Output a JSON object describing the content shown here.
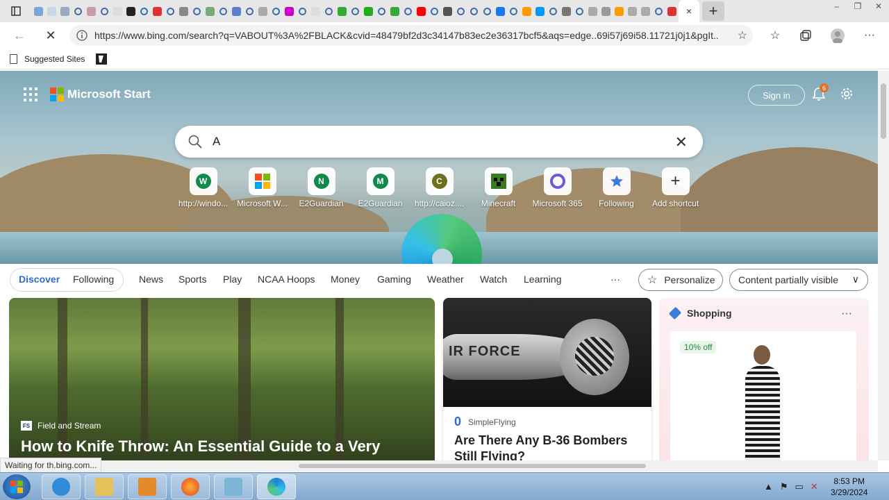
{
  "browser": {
    "active_tab_close": "×",
    "new_tab": "+",
    "window_controls": [
      "–",
      "❐",
      "✕"
    ],
    "url": "https://www.bing.com/search?q=VABOUT%3A%2FBLACK&cvid=48479bf2d3c34147b83ec2e36317bcf5&aqs=edge..69i57j69i58.11721j0j1&pgIt...",
    "favorites_bar": {
      "items": [
        "Suggested Sites"
      ]
    }
  },
  "page": {
    "brand": "Microsoft Start",
    "sign_in": "Sign in",
    "notification_count": "6",
    "search": {
      "value": "A"
    },
    "shortcuts": [
      {
        "label": "http://windo...",
        "letter": "W",
        "color": "#0f8a4a"
      },
      {
        "label": "Microsoft W...",
        "letter": "",
        "color": ""
      },
      {
        "label": "E2Guardian",
        "letter": "N",
        "color": "#0f8a4a"
      },
      {
        "label": "E2Guardian",
        "letter": "M",
        "color": "#0f8a4a"
      },
      {
        "label": "http://caioz....",
        "letter": "C",
        "color": "#6e6e1c"
      },
      {
        "label": "Minecraft",
        "letter": "",
        "color": "#3a7a22"
      },
      {
        "label": "Microsoft 365",
        "letter": "",
        "color": "#6a5bd6"
      },
      {
        "label": "Following",
        "letter": "",
        "color": "#3b7be0"
      },
      {
        "label": "Add shortcut",
        "letter": "",
        "color": ""
      }
    ],
    "nav": {
      "tabs": [
        "Discover",
        "Following"
      ],
      "links": [
        "News",
        "Sports",
        "Play",
        "NCAA Hoops",
        "Money",
        "Gaming",
        "Weather",
        "Watch",
        "Learning"
      ],
      "more": "···",
      "personalize": "Personalize",
      "content_filter": "Content partially visible"
    },
    "cards": [
      {
        "source_logo": "FS",
        "source": "Field and Stream",
        "headline": "How to Knife Throw: An Essential Guide to a Very"
      },
      {
        "image_text": "IR FORCE",
        "source_logo": "0",
        "source": "SimpleFlying",
        "headline": "Are There Any B-36 Bombers Still Flying?"
      },
      {
        "title": "Shopping",
        "more": "···",
        "discount": "10% off"
      }
    ]
  },
  "status": "Waiting for th.bing.com...",
  "taskbar": {
    "time": "8:53 PM",
    "date": "3/29/2024"
  },
  "colors": {
    "accent": "#2b6cd0",
    "brand_text": "#ffffff"
  }
}
